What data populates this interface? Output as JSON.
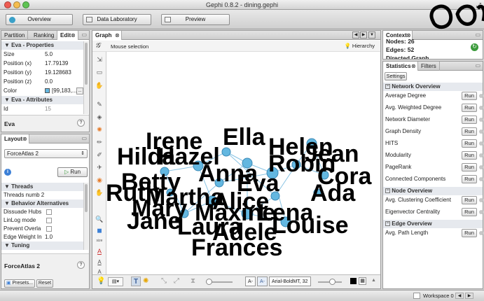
{
  "window": {
    "title": "Gephi 0.8.2 - dining.gephi"
  },
  "toolbar": {
    "overview": "Overview",
    "data_laboratory": "Data Laboratory",
    "preview": "Preview"
  },
  "left_top": {
    "tabs": [
      "Partition",
      "Ranking",
      "Edit"
    ],
    "section_props": "Eva - Properties",
    "props": [
      {
        "label": "Size",
        "value": "5.0"
      },
      {
        "label": "Position (x)",
        "value": "17.79139"
      },
      {
        "label": "Position (y)",
        "value": "19.128683"
      },
      {
        "label": "Position (z)",
        "value": "0.0"
      },
      {
        "label": "Color",
        "value": "[99,183,..."
      }
    ],
    "section_attrs": "Eva - Attributes",
    "attrs": [
      {
        "label": "Id",
        "value": "15"
      }
    ],
    "footer": "Eva"
  },
  "layout": {
    "tab": "Layout",
    "algorithm": "ForceAtlas 2",
    "run": "Run",
    "section_threads": "Threads",
    "threads_row": "Threads numb 2",
    "section_behavior": "Behavior Alternatives",
    "behavior": [
      {
        "label": "Dissuade Hubs",
        "value": ""
      },
      {
        "label": "LinLog mode",
        "value": ""
      },
      {
        "label": "Prevent Overla",
        "value": ""
      },
      {
        "label": "Edge Weight In",
        "value": "1.0"
      }
    ],
    "section_tuning": "Tuning",
    "footer": "ForceAtlas 2",
    "presets": "Presets...",
    "reset": "Reset"
  },
  "graph": {
    "tab": "Graph",
    "mode": "Mouse selection",
    "hierarchy": "Hierarchy",
    "font": "Arial-BoldMT, 32",
    "labels": [
      "Irene",
      "Ella",
      "Helen",
      "Hilda",
      "Hazel",
      "Jean",
      "Robin",
      "Betty",
      "Anna",
      "Cora",
      "Eva",
      "Ruth",
      "Martha",
      "Alice",
      "Ada",
      "Mary",
      "Maxine",
      "Lena",
      "Jane",
      "Louise",
      "Laura",
      "Adele",
      "Frances"
    ]
  },
  "context": {
    "tab": "Context",
    "nodes_label": "Nodes:",
    "nodes": "26",
    "edges_label": "Edges:",
    "edges": "52",
    "graph_type": "Directed Graph"
  },
  "stats": {
    "tabs": [
      "Statistics",
      "Filters"
    ],
    "settings": "Settings",
    "sections": [
      {
        "title": "Network Overview",
        "items": [
          "Average Degree",
          "Avg. Weighted Degree",
          "Network Diameter",
          "Graph Density",
          "HITS",
          "Modularity",
          "PageRank",
          "Connected Components"
        ]
      },
      {
        "title": "Node Overview",
        "items": [
          "Avg. Clustering Coefficient",
          "Eigenvector Centrality"
        ]
      },
      {
        "title": "Edge Overview",
        "items": [
          "Avg. Path Length"
        ]
      }
    ],
    "run": "Run"
  },
  "status": {
    "workspace": "Workspace 0"
  },
  "colors": {
    "node": "#63b7e0",
    "accent": "#3b7fd6",
    "green": "#3a9a3a"
  }
}
